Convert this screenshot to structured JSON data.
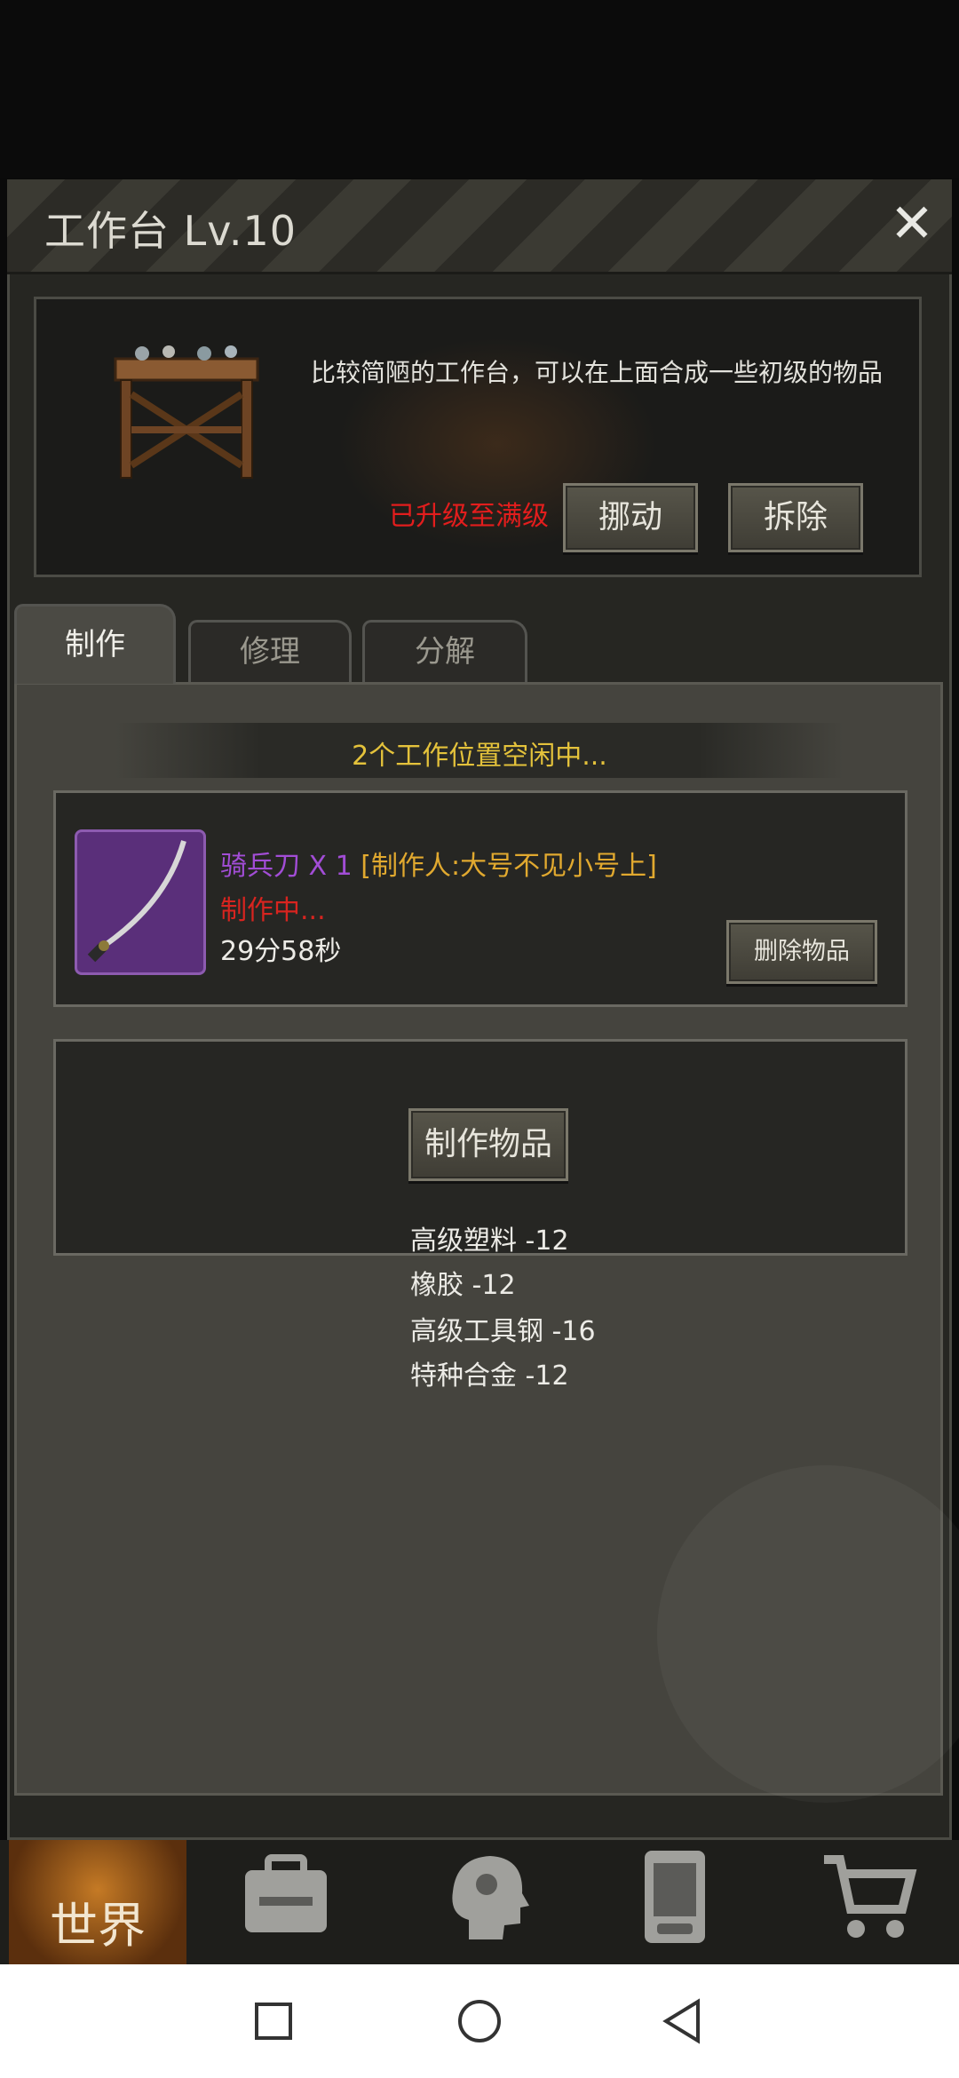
{
  "modal": {
    "title": "工作台 Lv.10",
    "close_icon": "close-icon"
  },
  "workbench": {
    "description": "比较简陋的工作台，可以在上面合成一些初级的物品",
    "status": "已升级至满级",
    "move_label": "挪动",
    "remove_label": "拆除"
  },
  "tabs": [
    {
      "label": "制作",
      "active": true
    },
    {
      "label": "修理",
      "active": false
    },
    {
      "label": "分解",
      "active": false
    }
  ],
  "crafting": {
    "slots_text": "2个工作位置空闲中...",
    "job": {
      "item_name": "骑兵刀 X 1",
      "maker": "[制作人:大号不见小号上]",
      "status": "制作中...",
      "time_left": "29分58秒",
      "delete_label": "删除物品"
    },
    "craft_label": "制作物品",
    "materials": [
      "高级塑料 -12",
      "橡胶 -12",
      "高级工具钢 -16",
      "特种合金 -12"
    ]
  },
  "bottom_nav": {
    "world_label": "世界",
    "items": [
      "backpack-icon",
      "head-icon",
      "phone-icon",
      "cart-icon"
    ]
  },
  "colors": {
    "accent_yellow": "#e4c23b",
    "status_red": "#d8241f",
    "item_purple": "#a24dd6",
    "maker_orange": "#e1a92f"
  }
}
